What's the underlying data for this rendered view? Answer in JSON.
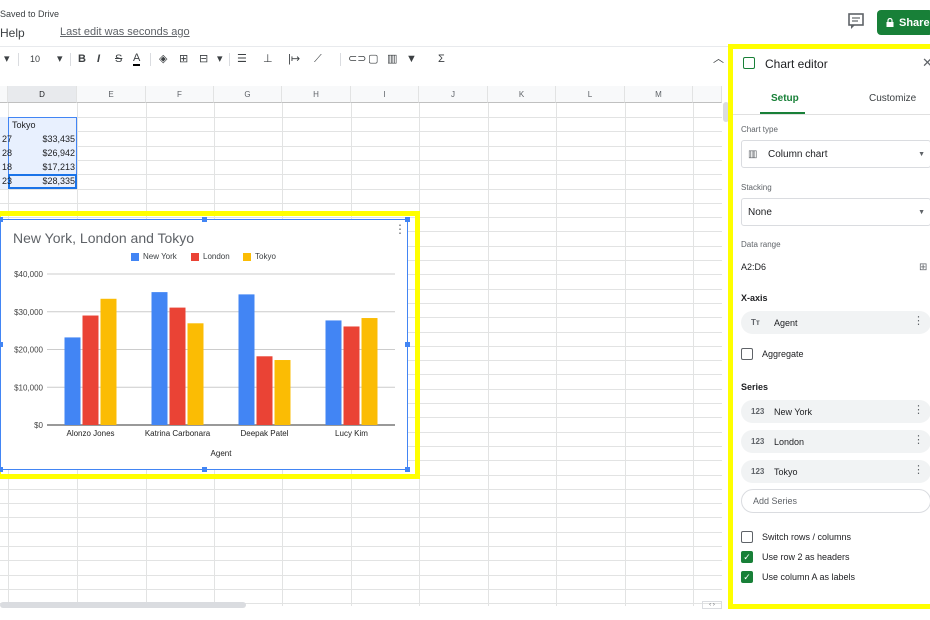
{
  "header": {
    "status": "Saved to Drive",
    "menu_help": "Help",
    "last_edit": "Last edit was seconds ago",
    "share_label": "Share"
  },
  "toolbar": {
    "font_size": "10",
    "items": [
      "B",
      "I",
      "S",
      "A",
      "▾",
      "Σ"
    ]
  },
  "sheet": {
    "columns": [
      "D",
      "E",
      "F",
      "G",
      "H",
      "I",
      "J",
      "K",
      "L",
      "M"
    ],
    "partial_left_cells": [
      "27",
      "28",
      "18",
      "23"
    ],
    "header_cell": "Tokyo",
    "values": [
      "$33,435",
      "$26,942",
      "$17,213",
      "$28,335"
    ]
  },
  "chart": {
    "menu_icon": "kebab-icon"
  },
  "chart_data": {
    "type": "bar",
    "title": "New York, London and Tokyo",
    "xlabel": "Agent",
    "ylabel": "",
    "categories": [
      "Alonzo Jones",
      "Katrina Carbonara",
      "Deepak Patel",
      "Lucy Kim"
    ],
    "series": [
      {
        "name": "New York",
        "color": "#4285f4",
        "values": [
          23200,
          35200,
          34600,
          27700
        ]
      },
      {
        "name": "London",
        "color": "#ea4335",
        "values": [
          29000,
          31100,
          18200,
          26100
        ]
      },
      {
        "name": "Tokyo",
        "color": "#fbbc04",
        "values": [
          33435,
          26942,
          17213,
          28335
        ]
      }
    ],
    "y_ticks": [
      "$0",
      "$10,000",
      "$20,000",
      "$30,000",
      "$40,000"
    ],
    "ylim": [
      0,
      40000
    ],
    "grid": true,
    "legend_position": "top"
  },
  "editor": {
    "title": "Chart editor",
    "tabs": [
      "Setup",
      "Customize"
    ],
    "chart_type_label": "Chart type",
    "chart_type_value": "Column chart",
    "stacking_label": "Stacking",
    "stacking_value": "None",
    "data_range_label": "Data range",
    "data_range_value": "A2:D6",
    "xaxis_label": "X-axis",
    "xaxis_value": "Agent",
    "xaxis_icon": "Tт",
    "aggregate_label": "Aggregate",
    "series_label": "Series",
    "series_icon": "123",
    "series": [
      "New York",
      "London",
      "Tokyo"
    ],
    "add_series": "Add Series",
    "options": [
      {
        "label": "Switch rows / columns",
        "checked": false
      },
      {
        "label": "Use row 2 as headers",
        "checked": true
      },
      {
        "label": "Use column A as labels",
        "checked": true
      }
    ]
  }
}
